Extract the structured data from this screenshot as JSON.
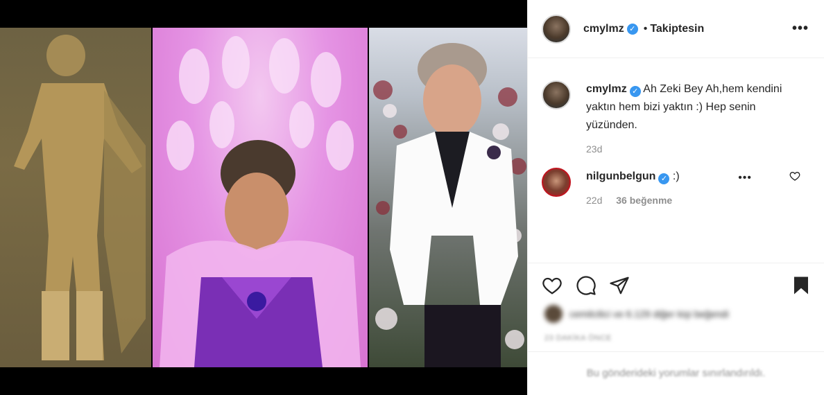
{
  "post": {
    "author": "cmylmz",
    "follow_dot": "•",
    "follow_status": "Takiptesin",
    "more_label": "•••",
    "verified_mark": "✓"
  },
  "comments": [
    {
      "username": "cmylmz",
      "text": "Ah Zeki Bey Ah,hem kendini yaktın hem bizi yaktın :) Hep senin yüzünden.",
      "time": "23d",
      "likes": ""
    },
    {
      "username": "nilgunbelgun",
      "text": ":)",
      "time": "22d",
      "likes": "36 beğenme",
      "more_label": "•••"
    }
  ],
  "actions": {
    "icons": [
      "heart-icon",
      "comment-icon",
      "share-icon",
      "bookmark-icon"
    ]
  },
  "likes_line": {
    "blurred_text": "cemilcilici ve 6.129 diğer kişi beğendi"
  },
  "post_time": "23 DAKİKA ÖNCE",
  "comments_restricted_note": "Bu gönderideki yorumlar sınırlandırıldı.",
  "colors": {
    "verified": "#3897f0",
    "meta_gray": "#8e8e8e",
    "divider": "#efefef"
  }
}
